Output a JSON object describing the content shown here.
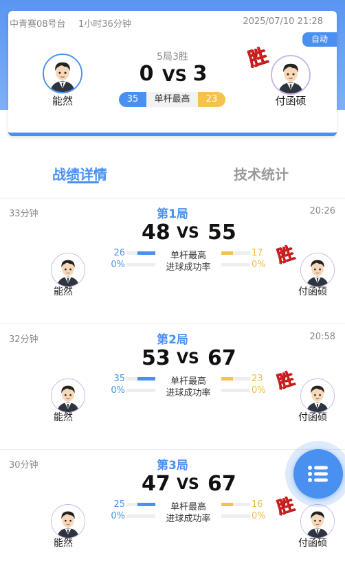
{
  "header": {
    "table_name": "中青赛08号台",
    "duration": "1小时36分钟",
    "datetime": "2025/07/10 21:28",
    "auto_label": "自动",
    "format": "5局3胜",
    "score_left": "0",
    "vs": "VS",
    "score_right": "3",
    "high_break_left": "35",
    "high_break_label": "单杆最高",
    "high_break_right": "23",
    "win_label": "胜"
  },
  "players": {
    "left": "能然",
    "right": "付函硕"
  },
  "tabs": {
    "detail": "战绩详情",
    "stats": "技术统计"
  },
  "games": [
    {
      "title": "第1局",
      "minutes": "33分钟",
      "time": "20:26",
      "score_left": "48",
      "score_right": "55",
      "high_break_label": "单杆最高",
      "high_break_left": "26",
      "high_break_right": "17",
      "high_break_left_fill": 0.62,
      "high_break_right_fill": 0.4,
      "potting_label": "进球成功率",
      "potting_left": "0%",
      "potting_right": "0%",
      "win_label": "胜"
    },
    {
      "title": "第2局",
      "minutes": "32分钟",
      "time": "20:58",
      "score_left": "53",
      "score_right": "67",
      "high_break_label": "单杆最高",
      "high_break_left": "35",
      "high_break_right": "23",
      "high_break_left_fill": 0.62,
      "high_break_right_fill": 0.4,
      "potting_label": "进球成功率",
      "potting_left": "0%",
      "potting_right": "0%",
      "win_label": "胜"
    },
    {
      "title": "第3局",
      "minutes": "30分钟",
      "time": "",
      "score_left": "47",
      "score_right": "67",
      "high_break_label": "单杆最高",
      "high_break_left": "25",
      "high_break_right": "16",
      "high_break_left_fill": 0.62,
      "high_break_right_fill": 0.4,
      "potting_label": "进球成功率",
      "potting_left": "0%",
      "potting_right": "0%",
      "win_label": "胜"
    }
  ],
  "colors": {
    "primary": "#4a90f0",
    "accent": "#f5c24c",
    "win": "#d21f1f"
  },
  "icons": {
    "avatar": "cartoon-player-avatar",
    "fab": "menu-list-icon"
  }
}
